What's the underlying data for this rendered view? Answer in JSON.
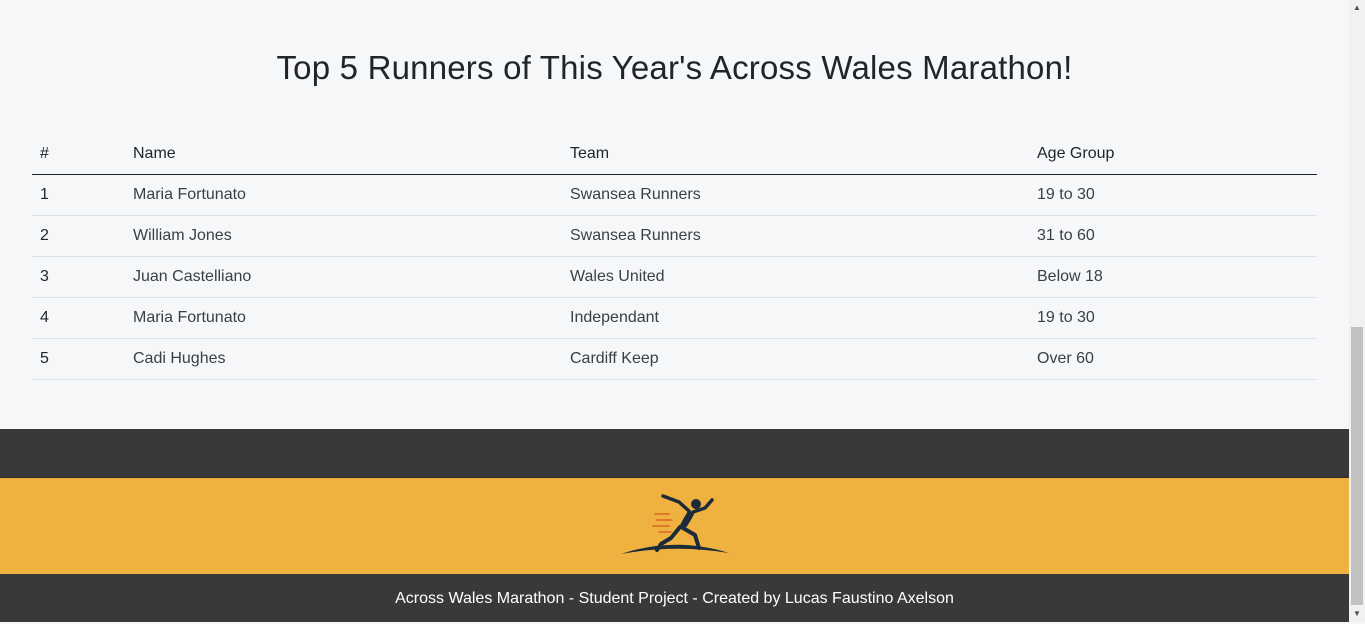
{
  "page_title": "Top 5 Runners of This Year's Across Wales Marathon!",
  "table": {
    "headers": [
      "#",
      "Name",
      "Team",
      "Age Group"
    ],
    "rows": [
      {
        "rank": "1",
        "name": "Maria Fortunato",
        "team": "Swansea Runners",
        "age": "19 to 30"
      },
      {
        "rank": "2",
        "name": "William Jones",
        "team": "Swansea Runners",
        "age": "31 to 60"
      },
      {
        "rank": "3",
        "name": "Juan Castelliano",
        "team": "Wales United",
        "age": "Below 18"
      },
      {
        "rank": "4",
        "name": "Maria Fortunato",
        "team": "Independant",
        "age": "19 to 30"
      },
      {
        "rank": "5",
        "name": "Cadi Hughes",
        "team": "Cardiff Keep",
        "age": "Over 60"
      }
    ]
  },
  "footer": {
    "text": "Across Wales Marathon - Student Project - Created by Lucas Faustino Axelson"
  },
  "logo": {
    "icon": "runner-logo-icon"
  },
  "colors": {
    "background": "#f6f7f9",
    "footer_dark": "#393939",
    "logo_band": "#efb241",
    "logo_figure": "#1c2b3a"
  }
}
